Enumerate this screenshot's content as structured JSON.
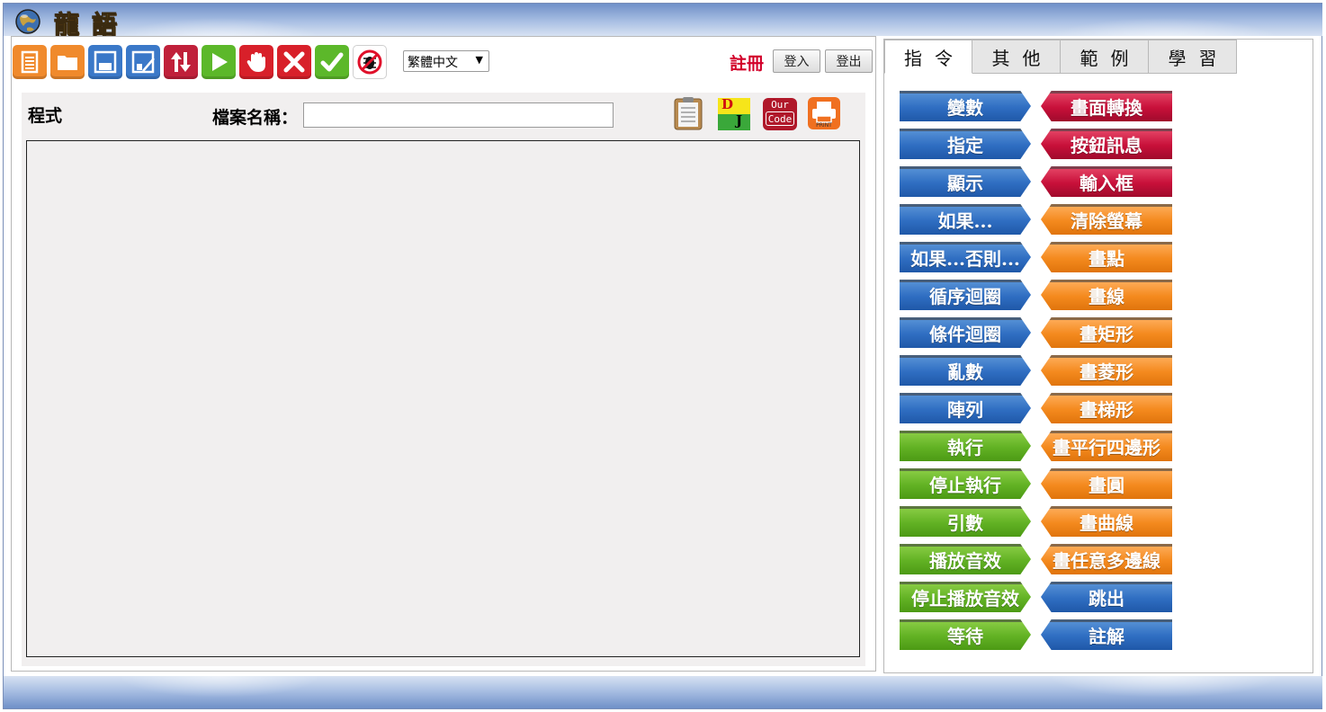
{
  "app": {
    "logo_text": "龍語"
  },
  "toolbar": {
    "buttons": [
      {
        "name": "new-file",
        "icon": "document-icon",
        "color": "#f08a2c"
      },
      {
        "name": "open-file",
        "icon": "folder-icon",
        "color": "#f08a2c"
      },
      {
        "name": "save",
        "icon": "floppy-icon",
        "color": "#3a78c8"
      },
      {
        "name": "save-as",
        "icon": "floppy-edit-icon",
        "color": "#3a78c8"
      },
      {
        "name": "swap",
        "icon": "up-down-arrows-icon",
        "color": "#c0203a"
      },
      {
        "name": "run",
        "icon": "play-icon",
        "color": "#5cb82a"
      },
      {
        "name": "stop",
        "icon": "hand-icon",
        "color": "#d8202a"
      },
      {
        "name": "close",
        "icon": "x-icon",
        "color": "#d8202a"
      },
      {
        "name": "check",
        "icon": "check-icon",
        "color": "#5cb82a"
      },
      {
        "name": "no-bug",
        "icon": "no-bug-icon",
        "color": "#ffffff"
      }
    ],
    "language_selected": "繁體中文",
    "register_label": "註冊",
    "login_label": "登入",
    "logout_label": "登出"
  },
  "editor": {
    "program_label": "程式",
    "filename_label": "檔案名稱：",
    "filename_value": "",
    "side_icons": [
      {
        "name": "clipboard-icon"
      },
      {
        "name": "dj-icon",
        "text_top": "D",
        "text_bottom": "J"
      },
      {
        "name": "our-code-icon",
        "text_top": "Our",
        "text_bottom": "Code"
      },
      {
        "name": "print-icon",
        "text": "PRINT"
      }
    ]
  },
  "tabs": [
    {
      "label": "指令",
      "active": true
    },
    {
      "label": "其他",
      "active": false
    },
    {
      "label": "範例",
      "active": false
    },
    {
      "label": "學習",
      "active": false
    }
  ],
  "commands_left": [
    {
      "label": "變數",
      "color": "blue"
    },
    {
      "label": "指定",
      "color": "blue"
    },
    {
      "label": "顯示",
      "color": "blue"
    },
    {
      "label": "如果...",
      "color": "blue"
    },
    {
      "label": "如果...否則...",
      "color": "blue"
    },
    {
      "label": "循序迴圈",
      "color": "blue"
    },
    {
      "label": "條件迴圈",
      "color": "blue"
    },
    {
      "label": "亂數",
      "color": "blue"
    },
    {
      "label": "陣列",
      "color": "blue"
    },
    {
      "label": "執行",
      "color": "green"
    },
    {
      "label": "停止執行",
      "color": "green"
    },
    {
      "label": "引數",
      "color": "green"
    },
    {
      "label": "播放音效",
      "color": "green"
    },
    {
      "label": "停止播放音效",
      "color": "green"
    },
    {
      "label": "等待",
      "color": "green"
    }
  ],
  "commands_right": [
    {
      "label": "畫面轉換",
      "color": "red"
    },
    {
      "label": "按鈕訊息",
      "color": "red"
    },
    {
      "label": "輸入框",
      "color": "red"
    },
    {
      "label": "清除螢幕",
      "color": "orange"
    },
    {
      "label": "畫點",
      "color": "orange"
    },
    {
      "label": "畫線",
      "color": "orange"
    },
    {
      "label": "畫矩形",
      "color": "orange"
    },
    {
      "label": "畫菱形",
      "color": "orange"
    },
    {
      "label": "畫梯形",
      "color": "orange"
    },
    {
      "label": "畫平行四邊形",
      "color": "orange"
    },
    {
      "label": "畫圓",
      "color": "orange"
    },
    {
      "label": "畫曲線",
      "color": "orange"
    },
    {
      "label": "畫任意多邊線",
      "color": "orange"
    },
    {
      "label": "跳出",
      "color": "blue"
    },
    {
      "label": "註解",
      "color": "blue"
    }
  ]
}
